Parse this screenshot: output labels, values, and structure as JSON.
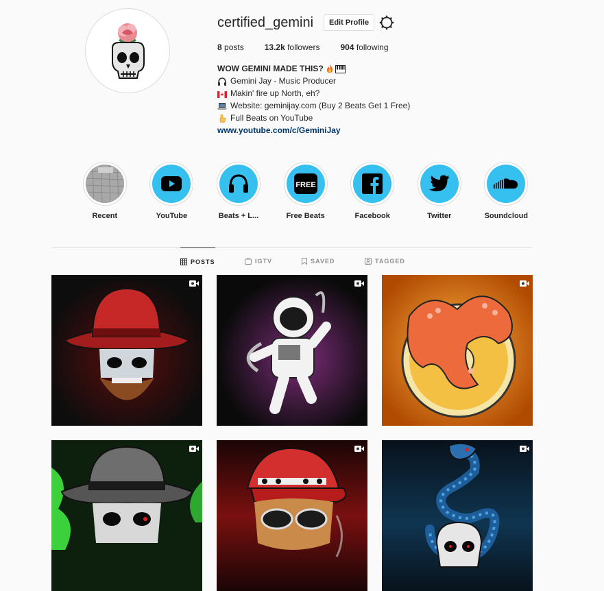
{
  "profile": {
    "username": "certified_gemini",
    "edit_label": "Edit Profile",
    "stats": {
      "posts_count": "8",
      "posts_label": "posts",
      "followers_count": "13.2k",
      "followers_label": "followers",
      "following_count": "904",
      "following_label": "following"
    },
    "bio": {
      "name": "WOW GEMINI MADE THIS?",
      "lines": [
        {
          "icon": "headphones-emoji-icon",
          "text": "Gemini Jay - Music Producer"
        },
        {
          "icon": "canada-flag-icon",
          "text": "Makin' fire up North, eh?"
        },
        {
          "icon": "laptop-emoji-icon",
          "text": "Website: geminijay.com (Buy 2 Beats Get 1 Free)"
        },
        {
          "icon": "pointing-down-emoji-icon",
          "text": "Full Beats on YouTube"
        }
      ],
      "link": "www.youtube.com/c/GeminiJay"
    }
  },
  "highlights": [
    {
      "label": "Recent",
      "icon": "recent-cover-image"
    },
    {
      "label": "YouTube",
      "icon": "youtube-icon"
    },
    {
      "label": "Beats + L...",
      "icon": "headphones-icon"
    },
    {
      "label": "Free Beats",
      "icon": "free-icon"
    },
    {
      "label": "Facebook",
      "icon": "facebook-icon"
    },
    {
      "label": "Twitter",
      "icon": "twitter-icon"
    },
    {
      "label": "Soundcloud",
      "icon": "soundcloud-icon"
    }
  ],
  "tabs": [
    {
      "label": "POSTS",
      "icon": "grid-icon",
      "active": true
    },
    {
      "label": "IGTV",
      "icon": "igtv-icon",
      "active": false
    },
    {
      "label": "SAVED",
      "icon": "bookmark-icon",
      "active": false
    },
    {
      "label": "TAGGED",
      "icon": "tagged-icon",
      "active": false
    }
  ],
  "posts": [
    {
      "subject": "skull-red-fedora",
      "bg": "#0d0d0d",
      "glow": "#b3261e"
    },
    {
      "subject": "astronaut",
      "bg": "#0a0a0a",
      "glow": "#c04fb0"
    },
    {
      "subject": "octopus-donut",
      "bg": "#f08a1c",
      "glow": "#ffd08a"
    },
    {
      "subject": "skull-gray-fedora-smoke",
      "bg": "#0a2a12",
      "glow": "#3bd13b"
    },
    {
      "subject": "monkey-red-cap",
      "bg": "#2a0808",
      "glow": "#c0281e"
    },
    {
      "subject": "snake-skull",
      "bg": "#07131f",
      "glow": "#1e6fa8"
    }
  ],
  "colors": {
    "highlight_blue": "#35c0ef",
    "link": "#00376b",
    "border": "#dbdbdb",
    "text": "#262626",
    "muted": "#8e8e8e"
  }
}
